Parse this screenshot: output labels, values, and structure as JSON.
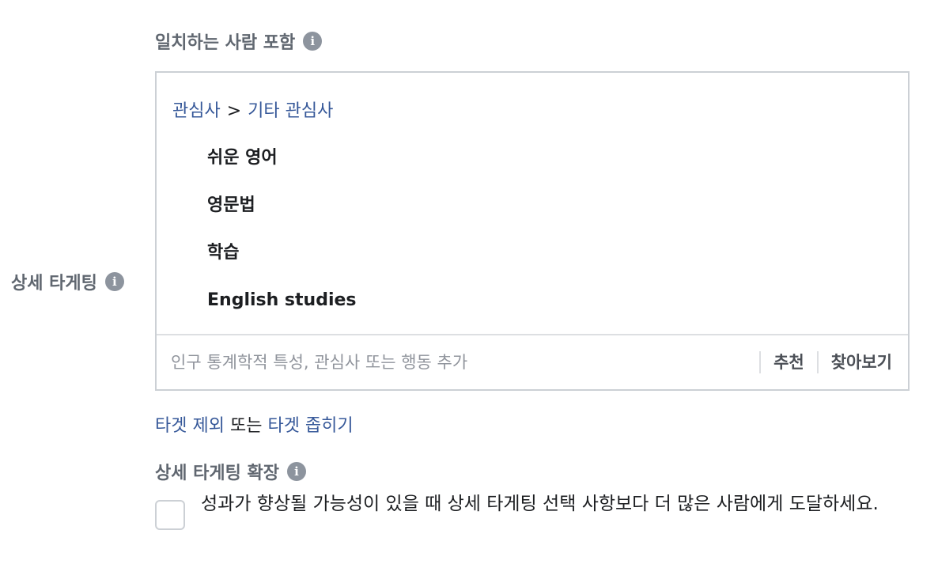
{
  "include_section": {
    "label": "일치하는 사람 포함"
  },
  "side": {
    "label": "상세 타게팅"
  },
  "targeting": {
    "breadcrumb_root": "관심사",
    "breadcrumb_separator": ">",
    "breadcrumb_child": "기타 관심사",
    "items": [
      "쉬운 영어",
      "영문법",
      "학습",
      "English studies"
    ],
    "search_placeholder": "인구 통계학적 특성, 관심사 또는 행동 추가",
    "suggestions_label": "추천",
    "browse_label": "찾아보기"
  },
  "narrow": {
    "exclude_label": "타겟 제외",
    "or_text": "또는",
    "narrow_label": "타겟 좁히기"
  },
  "expansion": {
    "label": "상세 타게팅 확장",
    "checkbox_checked": false,
    "description": "성과가 향상될 가능성이 있을 때 상세 타게팅 선택 사항보다 더 많은 사람에게 도달하세요."
  },
  "colors": {
    "link": "#365899",
    "label_gray": "#606770",
    "border": "#ccd0d5",
    "icon_gray": "#8d949e"
  },
  "icons": {
    "info": "info-icon"
  }
}
